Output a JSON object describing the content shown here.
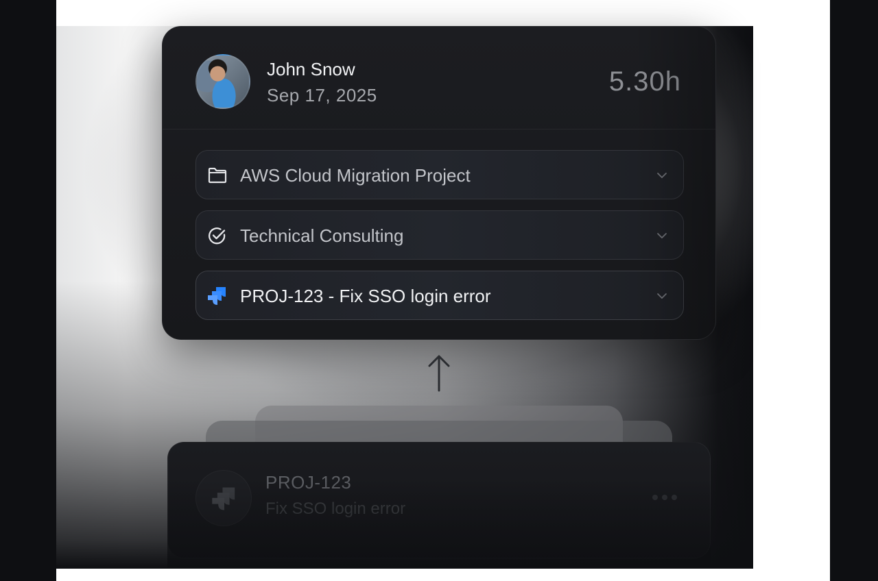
{
  "entry": {
    "user_name": "John Snow",
    "date": "Sep 17, 2025",
    "hours": "5.30h",
    "fields": [
      {
        "label": "AWS Cloud Migration Project",
        "icon": "folder-icon"
      },
      {
        "label": "Technical Consulting",
        "icon": "check-circle-icon"
      },
      {
        "label": "PROJ-123 - Fix SSO login error",
        "icon": "jira-icon"
      }
    ]
  },
  "ticket": {
    "key": "PROJ-123",
    "title": "Fix SSO login error",
    "icon": "jira-icon"
  },
  "colors": {
    "card_bg": "#1c1d21",
    "jira_blue": "#2684ff",
    "text_primary": "#f2f3f5",
    "text_secondary": "#a7a9ae"
  }
}
